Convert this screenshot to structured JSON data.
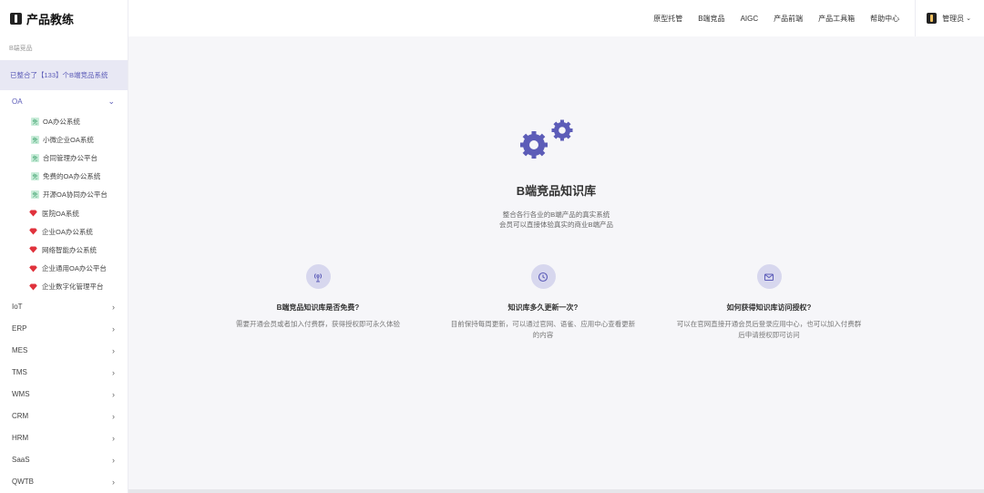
{
  "app": {
    "name": "产品教练"
  },
  "sidebar": {
    "section_label": "B端竞品",
    "banner": "已整合了【133】个B端竞品系统",
    "active_group": "OA",
    "oa_items": [
      {
        "label": "OA办公系统",
        "tag": "免",
        "type": "free"
      },
      {
        "label": "小微企业OA系统",
        "tag": "免",
        "type": "free"
      },
      {
        "label": "合同管理办公平台",
        "tag": "免",
        "type": "free"
      },
      {
        "label": "免费的OA办公系统",
        "tag": "免",
        "type": "free"
      },
      {
        "label": "开源OA协同办公平台",
        "tag": "免",
        "type": "free"
      },
      {
        "label": "医院OA系统",
        "type": "gem"
      },
      {
        "label": "企业OA办公系统",
        "type": "gem"
      },
      {
        "label": "网络智能办公系统",
        "type": "gem"
      },
      {
        "label": "企业通用OA办公平台",
        "type": "gem"
      },
      {
        "label": "企业数字化管理平台",
        "type": "gem"
      }
    ],
    "groups": [
      "IoT",
      "ERP",
      "MES",
      "TMS",
      "WMS",
      "CRM",
      "HRM",
      "SaaS",
      "QWTB"
    ]
  },
  "topnav": {
    "items": [
      "原型托管",
      "B端竞品",
      "AIGC",
      "产品前端",
      "产品工具箱",
      "帮助中心"
    ],
    "user": "管理员"
  },
  "hero": {
    "title": "B端竞品知识库",
    "line1": "整合各行各业的B端产品的真实系统",
    "line2": "会员可以直接体验真实的商业B端产品"
  },
  "features": [
    {
      "icon": "antenna-icon",
      "title": "B端竞品知识库是否免费?",
      "desc": "需要开通会员或者加入付费群，获得授权即可永久体验"
    },
    {
      "icon": "clock-icon",
      "title": "知识库多久更新一次?",
      "desc": "目前保持每周更新，可以通过官网、语雀、应用中心查看更新的内容"
    },
    {
      "icon": "mail-icon",
      "title": "如何获得知识库访问授权?",
      "desc": "可以在官网直接开通会员后登录应用中心，也可以加入付费群后申请授权即可访问"
    }
  ],
  "colors": {
    "accent": "#5c5cb8",
    "gem": "#e0323c",
    "free_bg": "#c9ecd9"
  }
}
